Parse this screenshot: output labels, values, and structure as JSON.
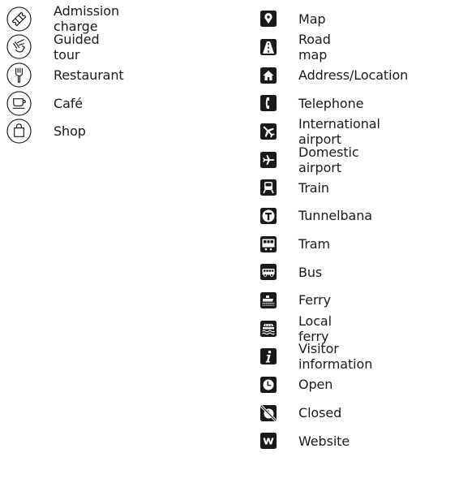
{
  "left_legend": [
    {
      "icon": "ticket-icon",
      "label": "Admission charge"
    },
    {
      "icon": "pointing-hand-icon",
      "label": "Guided tour"
    },
    {
      "icon": "fork-icon",
      "label": "Restaurant"
    },
    {
      "icon": "coffee-cup-icon",
      "label": "Café"
    },
    {
      "icon": "shopping-bag-icon",
      "label": "Shop"
    }
  ],
  "right_legend": [
    {
      "icon": "map-pin-icon",
      "label": "Map"
    },
    {
      "icon": "road-icon",
      "label": "Road map"
    },
    {
      "icon": "house-icon",
      "label": "Address/Location"
    },
    {
      "icon": "telephone-icon",
      "label": "Telephone"
    },
    {
      "icon": "airplane-icon",
      "label": "International airport"
    },
    {
      "icon": "domestic-airplane-icon",
      "label": "Domestic airport"
    },
    {
      "icon": "train-icon",
      "label": "Train"
    },
    {
      "icon": "tunnelbana-icon",
      "label": "Tunnelbana"
    },
    {
      "icon": "tram-icon",
      "label": "Tram"
    },
    {
      "icon": "bus-icon",
      "label": "Bus"
    },
    {
      "icon": "ferry-icon",
      "label": "Ferry"
    },
    {
      "icon": "local-ferry-icon",
      "label": "Local ferry"
    },
    {
      "icon": "info-icon",
      "label": "Visitor information"
    },
    {
      "icon": "clock-icon",
      "label": "Open"
    },
    {
      "icon": "clock-crossed-icon",
      "label": "Closed"
    },
    {
      "icon": "website-icon",
      "label": "Website"
    }
  ],
  "colors": {
    "icon_fill": "#1a1a1a",
    "text": "#1a1a1a",
    "background": "#ffffff"
  }
}
